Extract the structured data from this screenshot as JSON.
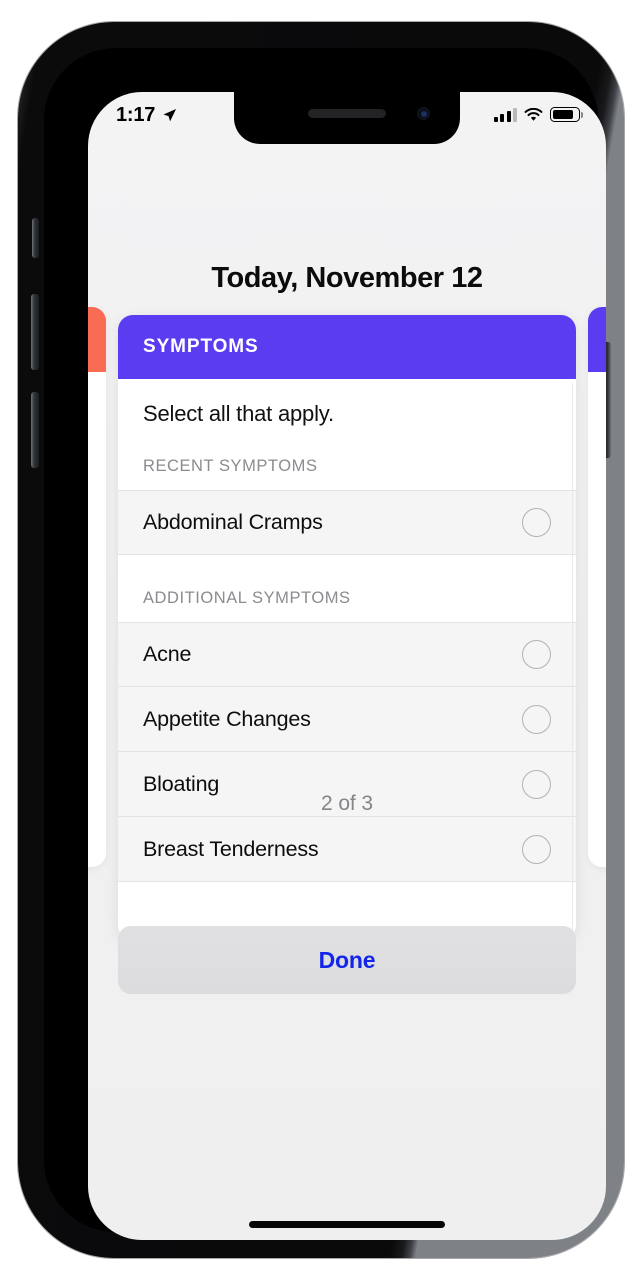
{
  "device": {
    "status_bar": {
      "time": "1:17",
      "location_icon": "location-arrow-icon",
      "signal_icon": "cellular-signal-icon",
      "signal_bars_filled": 3,
      "signal_bars_total": 4,
      "wifi_icon": "wifi-icon",
      "battery_icon": "battery-icon",
      "battery_level_percent": 82
    },
    "home_indicator": "home-indicator"
  },
  "header": {
    "title": "Today, November 12"
  },
  "card": {
    "header_label": "SYMPTOMS",
    "header_color": "#5b3cf0",
    "subtitle": "Select all that apply.",
    "sections": [
      {
        "title": "RECENT SYMPTOMS",
        "items": [
          {
            "label": "Abdominal Cramps",
            "selected": false
          }
        ]
      },
      {
        "title": "ADDITIONAL SYMPTOMS",
        "items": [
          {
            "label": "Acne",
            "selected": false
          },
          {
            "label": "Appetite Changes",
            "selected": false
          },
          {
            "label": "Bloating",
            "selected": false
          },
          {
            "label": "Breast Tenderness",
            "selected": false
          }
        ]
      }
    ]
  },
  "peek_cards": {
    "left": {
      "color": "#fa6b53"
    },
    "right": {
      "color": "#5b3cf0"
    }
  },
  "pager": {
    "label": "2 of 3",
    "current": 2,
    "total": 3
  },
  "footer": {
    "done_label": "Done",
    "done_text_color": "#1225e8"
  }
}
